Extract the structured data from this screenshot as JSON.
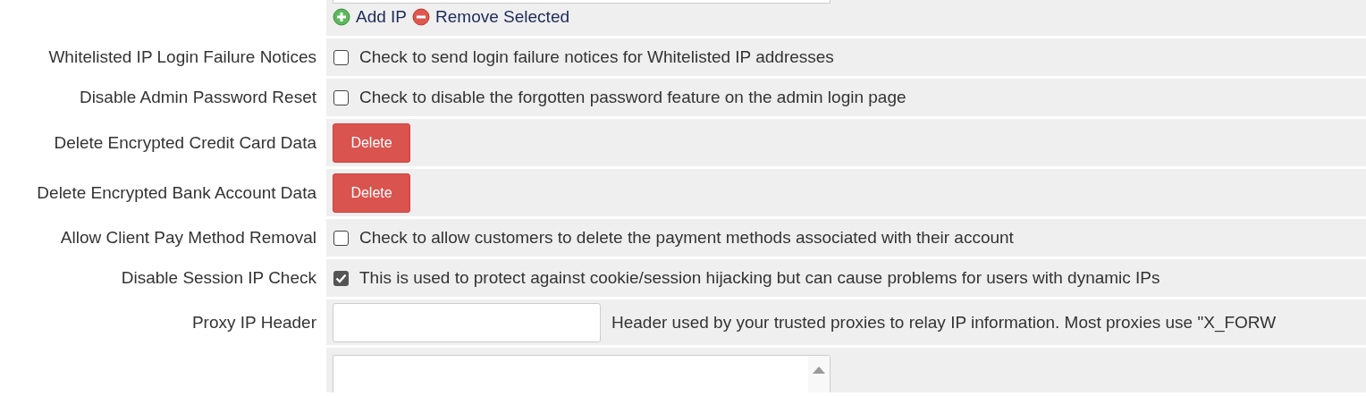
{
  "ip_list": {
    "add_link": "Add IP",
    "remove_link": "Remove Selected"
  },
  "settings": [
    {
      "kind": "checkbox",
      "label": "Whitelisted IP Login Failure Notices",
      "checked": false,
      "description": "Check to send login failure notices for Whitelisted IP addresses"
    },
    {
      "kind": "checkbox",
      "label": "Disable Admin Password Reset",
      "checked": false,
      "description": "Check to disable the forgotten password feature on the admin login page"
    },
    {
      "kind": "button",
      "label": "Delete Encrypted Credit Card Data",
      "button": "Delete"
    },
    {
      "kind": "button",
      "label": "Delete Encrypted Bank Account Data",
      "button": "Delete"
    },
    {
      "kind": "checkbox",
      "label": "Allow Client Pay Method Removal",
      "checked": false,
      "description": "Check to allow customers to delete the payment methods associated with their account"
    },
    {
      "kind": "checkbox",
      "label": "Disable Session IP Check",
      "checked": true,
      "description": "This is used to protect against cookie/session hijacking but can cause problems for users with dynamic IPs"
    },
    {
      "kind": "text",
      "label": "Proxy IP Header",
      "description": "Header used by your trusted proxies to relay IP information. Most proxies use \"X_FORW"
    },
    {
      "kind": "textarea"
    }
  ]
}
